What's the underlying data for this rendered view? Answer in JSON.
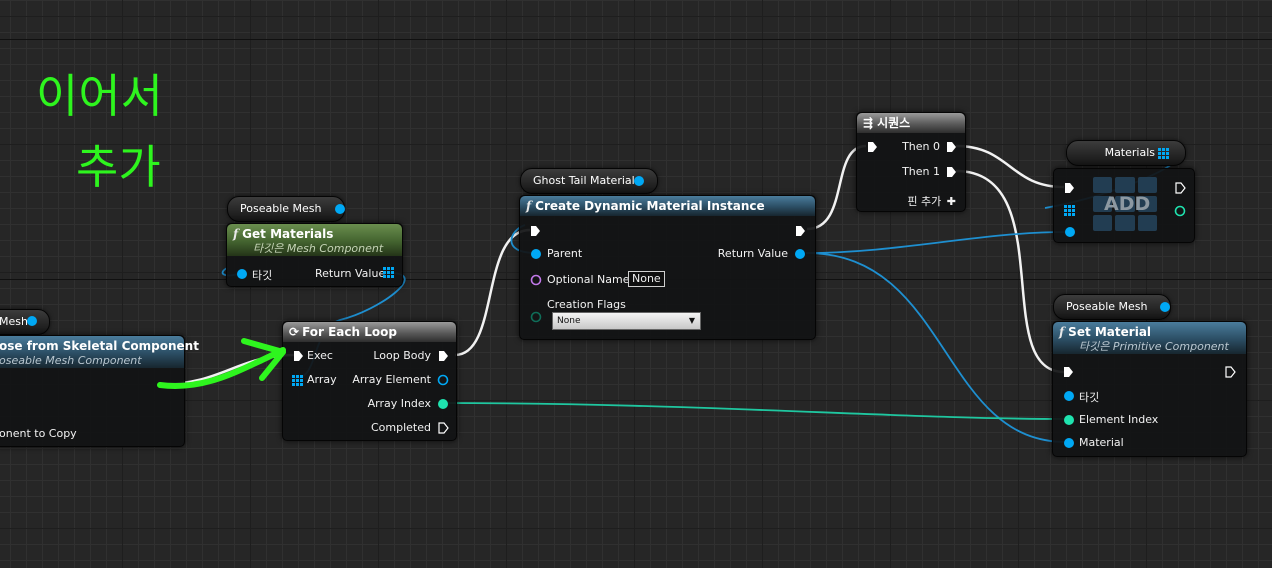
{
  "annotation": {
    "line1": "이어서",
    "line2": "추가"
  },
  "copy_pose_node": {
    "title": "ose from Skeletal Component",
    "subtitle": "oseable Mesh Component",
    "var_label": "Mesh",
    "pin_label": "onent to Copy"
  },
  "get_materials_node": {
    "title": "Get Materials",
    "subtitle": "타깃은 Mesh Component",
    "target_label": "타깃",
    "return_label": "Return Value",
    "var_label": "Poseable Mesh"
  },
  "for_each_node": {
    "title": "For Each Loop",
    "exec": "Exec",
    "array": "Array",
    "loop_body": "Loop Body",
    "array_element": "Array Element",
    "array_index": "Array Index",
    "completed": "Completed"
  },
  "create_dmi_node": {
    "title": "Create Dynamic Material Instance",
    "parent": "Parent",
    "return_value": "Return Value",
    "optional_name_label": "Optional Name",
    "optional_name_value": "None",
    "creation_flags_label": "Creation Flags",
    "creation_flags_value": "None",
    "var_label": "Ghost Tail Material"
  },
  "sequence_node": {
    "title": "시퀀스",
    "then0": "Then 0",
    "then1": "Then 1",
    "add_pin": "핀 추가"
  },
  "add_node": {
    "title": "ADD",
    "var_label": "Materials"
  },
  "set_material_node": {
    "title": "Set Material",
    "subtitle": "타깃은 Primitive Component",
    "target_label": "타깃",
    "element_index": "Element Index",
    "material": "Material",
    "var_label": "Poseable Mesh"
  },
  "colors": {
    "exec": "#ffffff",
    "object": "#00a8f4",
    "integer": "#1fe3af",
    "name": "#c178e8",
    "annotation": "#2ef51e"
  }
}
